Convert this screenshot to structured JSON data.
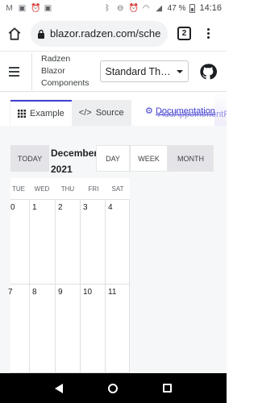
{
  "status_bar": {
    "time": "14:16",
    "battery": "47 %",
    "left_icons": [
      "gmail-icon",
      "image-icon",
      "alarm-icon",
      "image-icon"
    ],
    "right_icons": [
      "bluetooth-icon",
      "do-not-disturb-icon",
      "alarm-icon",
      "wifi-icon",
      "signal-icon",
      "battery-icon"
    ]
  },
  "browser": {
    "url": "blazor.radzen.com/sche",
    "tab_count": "2"
  },
  "header": {
    "brand_line1": "Radzen",
    "brand_line2": "Blazor",
    "brand_line3": "Components",
    "theme_value": "Standard The..."
  },
  "tabs": {
    "example": "Example",
    "source": "Source",
    "documentation": "Documentation",
    "ghost_text": "AddAppointmentP"
  },
  "scheduler": {
    "today": "TODAY",
    "month": "December",
    "year": "2021",
    "views": {
      "day": "DAY",
      "week": "WEEK",
      "month": "MONTH"
    },
    "active_view": "MONTH",
    "weekdays": [
      "TUE",
      "WED",
      "THU",
      "FRI",
      "SAT"
    ],
    "row1": [
      "0",
      "1",
      "2",
      "3",
      "4"
    ],
    "row2": [
      "7",
      "8",
      "9",
      "10",
      "11"
    ]
  },
  "colors": {
    "accent": "#4340d2",
    "tab_active_border": "#4340d2",
    "nav_bar": "#000000"
  }
}
